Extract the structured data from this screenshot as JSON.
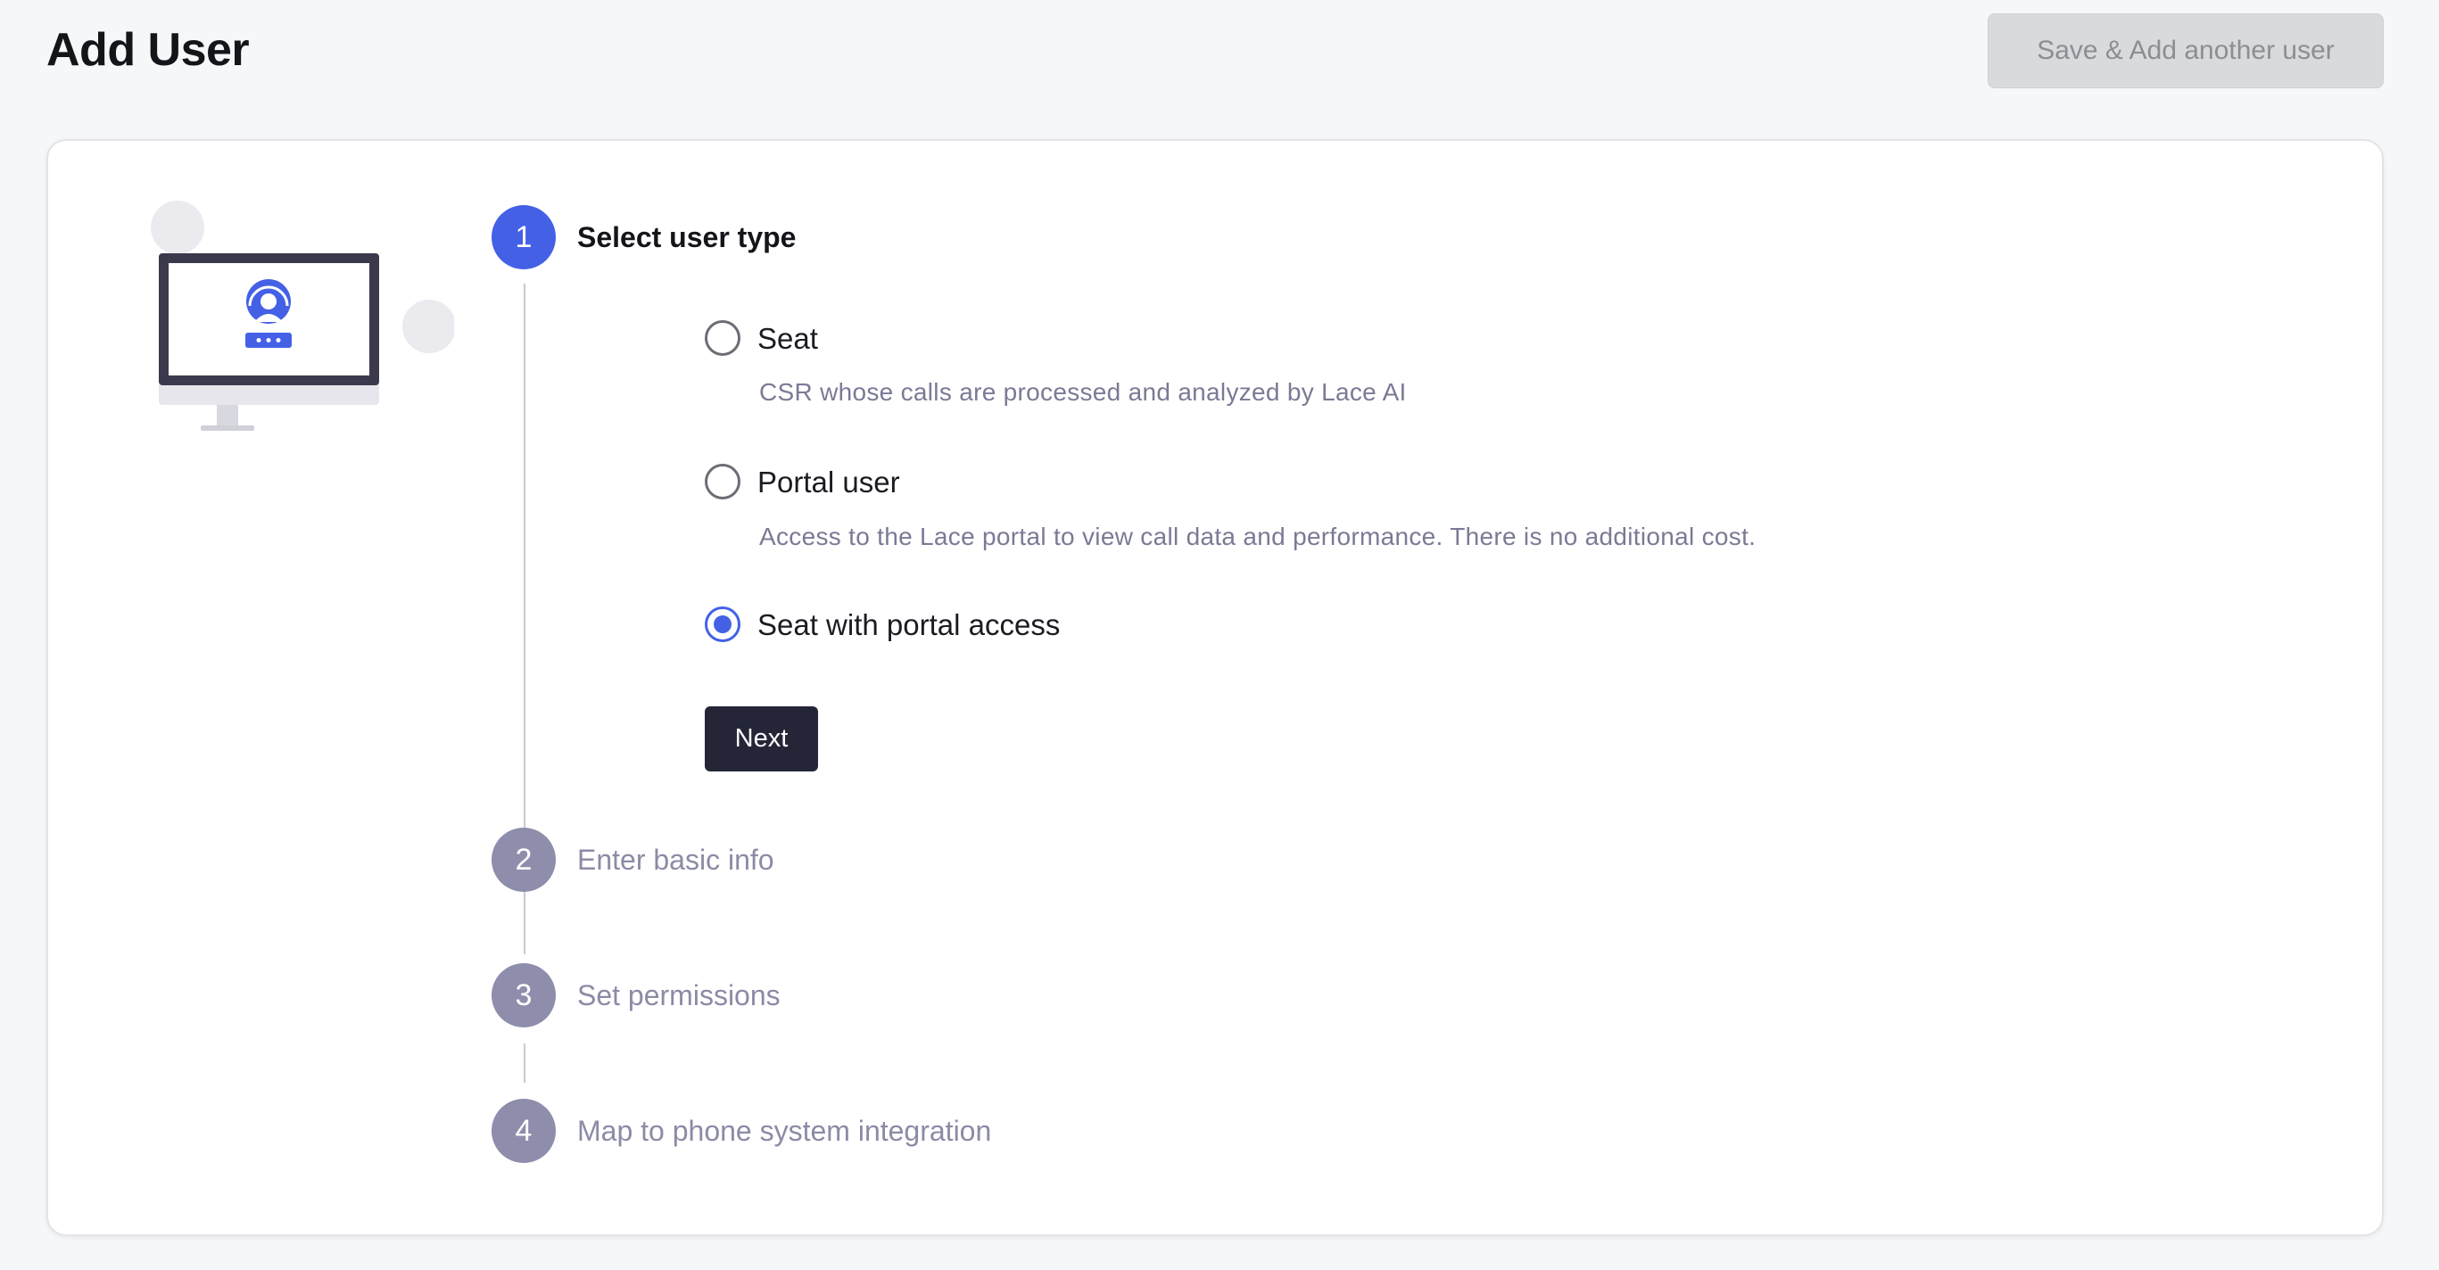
{
  "header": {
    "title": "Add User",
    "save_another_label": "Save & Add another user"
  },
  "steps": [
    {
      "number": "1",
      "title": "Select user type",
      "state": "active"
    },
    {
      "number": "2",
      "title": "Enter basic info",
      "state": "inactive"
    },
    {
      "number": "3",
      "title": "Set permissions",
      "state": "inactive"
    },
    {
      "number": "4",
      "title": "Map to phone system integration",
      "state": "inactive"
    }
  ],
  "user_types": [
    {
      "label": "Seat",
      "description": "CSR whose calls are processed and analyzed by Lace AI",
      "checked": false
    },
    {
      "label": "Portal user",
      "description": "Access to the Lace portal to view call data and performance. There is no additional cost.",
      "checked": false
    },
    {
      "label": "Seat with portal access",
      "description": "",
      "checked": true
    }
  ],
  "next_label": "Next",
  "colors": {
    "accent": "#4461e6",
    "inactive_step": "#8e8dac",
    "primary_button": "#242638",
    "disabled_button": "#d9dadc"
  },
  "icons": {
    "illustration": "monitor-headset-user-icon"
  }
}
